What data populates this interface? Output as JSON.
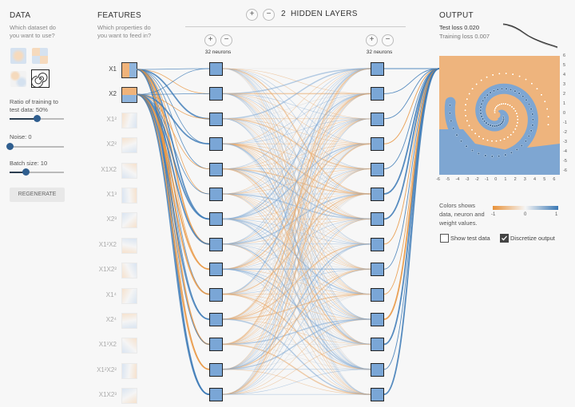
{
  "data_panel": {
    "title": "DATA",
    "question": [
      "Which dataset do",
      "you want to use?"
    ],
    "ratio_label": [
      "Ratio of training to",
      "test data:  50%"
    ],
    "ratio_value": 0.5,
    "noise_label": "Noise:  0",
    "noise_value": 0,
    "batch_label": "Batch size:  10",
    "batch_value": 0.3,
    "regenerate_label": "REGENERATE",
    "datasets": [
      "circle-dataset-icon",
      "xor-dataset-icon",
      "gaussian-dataset-icon",
      "spiral-dataset-icon"
    ],
    "selected_dataset": "spiral-dataset-icon"
  },
  "features_panel": {
    "title": "FEATURES",
    "question": [
      "Which properties do",
      "you want to feed in?"
    ],
    "features": [
      {
        "label": "X1",
        "active": true
      },
      {
        "label": "X2",
        "active": true
      },
      {
        "label": "X1²",
        "active": false
      },
      {
        "label": "X2²",
        "active": false
      },
      {
        "label": "X1X2",
        "active": false
      },
      {
        "label": "X1³",
        "active": false
      },
      {
        "label": "X2³",
        "active": false
      },
      {
        "label": "X1²X2",
        "active": false
      },
      {
        "label": "X1X2²",
        "active": false
      },
      {
        "label": "X1⁴",
        "active": false
      },
      {
        "label": "X2⁴",
        "active": false
      },
      {
        "label": "X1³X2",
        "active": false
      },
      {
        "label": "X1²X2²",
        "active": false
      },
      {
        "label": "X1X2³",
        "active": false
      }
    ]
  },
  "network": {
    "hidden_layers_count": "2",
    "hidden_layers_label": "HIDDEN LAYERS",
    "plus": "+",
    "minus": "−",
    "layers": [
      {
        "neurons_label": "32 neurons"
      },
      {
        "neurons_label": "32 neurons"
      }
    ]
  },
  "output_panel": {
    "title": "OUTPUT",
    "test_loss": "Test loss 0.020",
    "training_loss": "Training loss 0.007",
    "y_ticks": [
      "6",
      "5",
      "4",
      "3",
      "2",
      "1",
      "0",
      "-1",
      "-2",
      "-3",
      "-4",
      "-5",
      "-6"
    ],
    "x_ticks": [
      "-6",
      "-5",
      "-4",
      "-3",
      "-2",
      "-1",
      "0",
      "1",
      "2",
      "3",
      "4",
      "5",
      "6"
    ],
    "legend_text": [
      "Colors shows",
      "data, neuron and",
      "weight values."
    ],
    "legend_ticks": [
      "-1",
      "0",
      "1"
    ],
    "show_test_data_label": "Show test data",
    "show_test_data": false,
    "discretize_label": "Discretize output",
    "discretize": true
  },
  "colors": {
    "positive": "#3a78b5",
    "negative": "#e8923a",
    "node": "#7aa6d6"
  }
}
